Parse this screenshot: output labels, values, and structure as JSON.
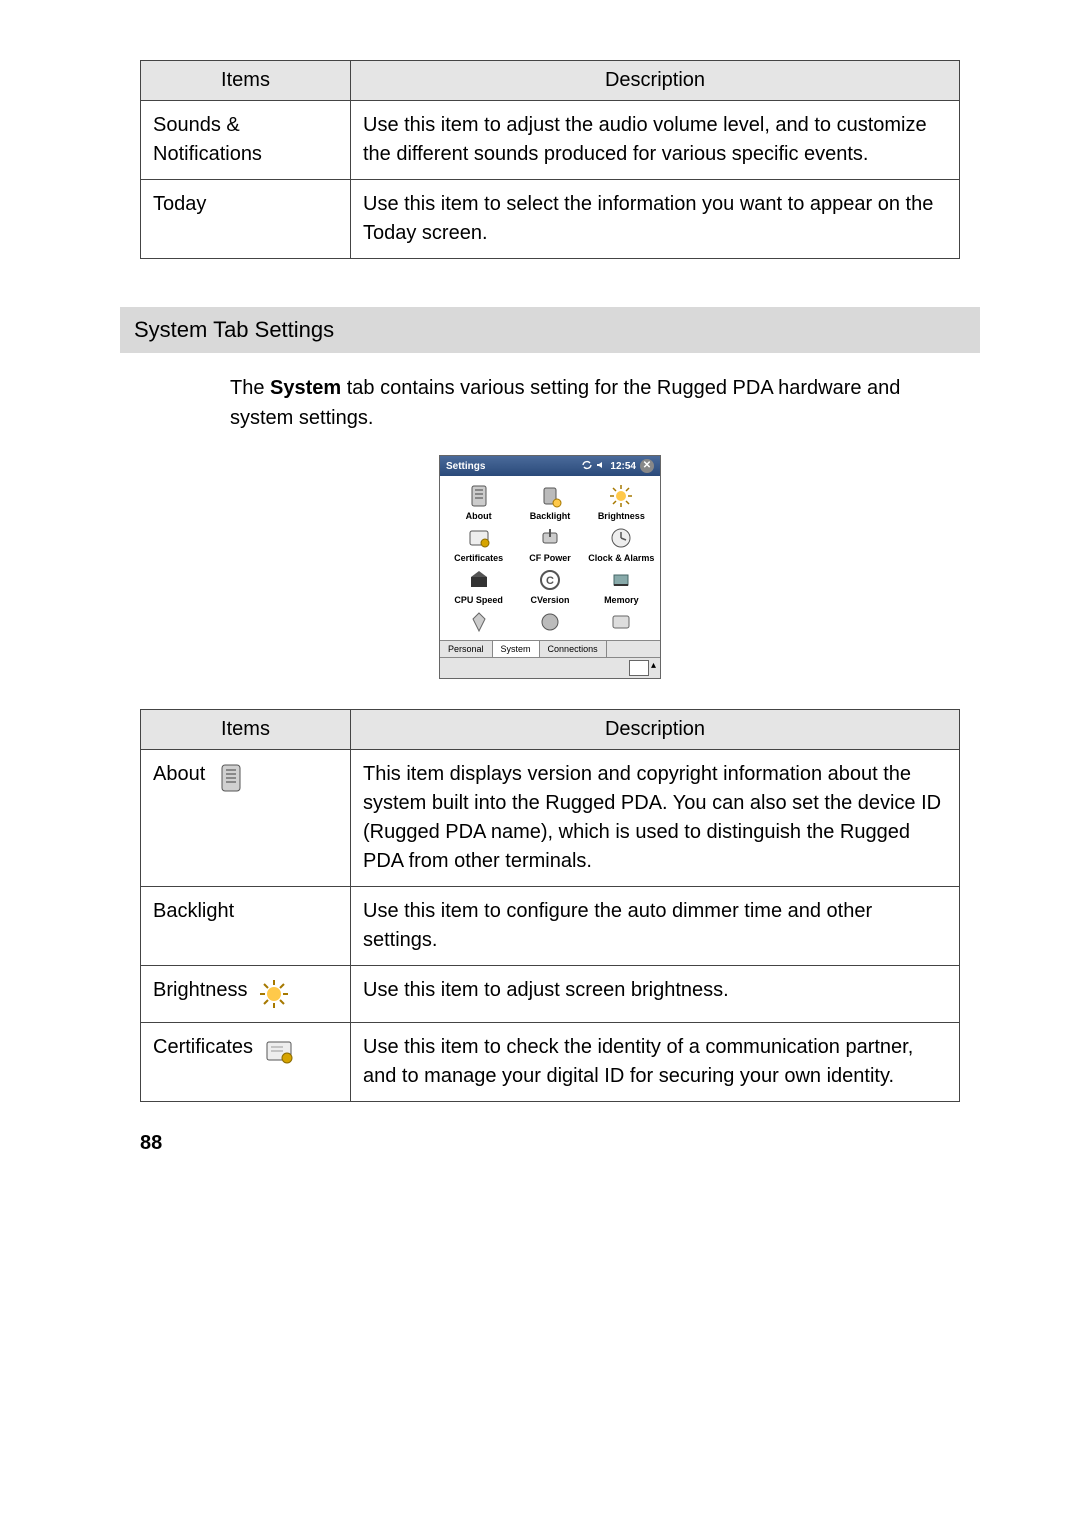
{
  "table1": {
    "headers": {
      "items": "Items",
      "description": "Description"
    },
    "rows": [
      {
        "item": "Sounds & Notifications",
        "desc": "Use this item to adjust the audio volume level, and to customize the different sounds produced for various specific events."
      },
      {
        "item": "Today",
        "desc": "Use this item to select the information you want to appear on the Today screen."
      }
    ]
  },
  "section": {
    "title": "System Tab Settings",
    "intro_a": "The ",
    "intro_bold": "System",
    "intro_b": " tab contains various setting for the Rugged PDA hardware and system settings."
  },
  "screenshot": {
    "title": "Settings",
    "time": "12:54",
    "items": [
      "About",
      "Backlight",
      "Brightness",
      "Certificates",
      "CF Power",
      "Clock & Alarms",
      "CPU Speed",
      "CVersion",
      "Memory",
      "",
      "",
      ""
    ],
    "tabs": {
      "personal": "Personal",
      "system": "System",
      "connections": "Connections"
    }
  },
  "table2": {
    "headers": {
      "items": "Items",
      "description": "Description"
    },
    "rows": [
      {
        "item": "About",
        "desc": "This item displays version and copyright information about the system built into the Rugged PDA. You can also set the device ID (Rugged PDA name), which is used to distinguish the Rugged PDA from other terminals."
      },
      {
        "item": "Backlight",
        "desc": "Use this item to configure the auto dimmer time and other settings."
      },
      {
        "item": "Brightness",
        "desc": "Use this item to adjust screen brightness."
      },
      {
        "item": "Certificates",
        "desc": "Use this item to check the identity of a communication partner, and to manage your digital ID for securing your own identity."
      }
    ]
  },
  "page_number": "88"
}
